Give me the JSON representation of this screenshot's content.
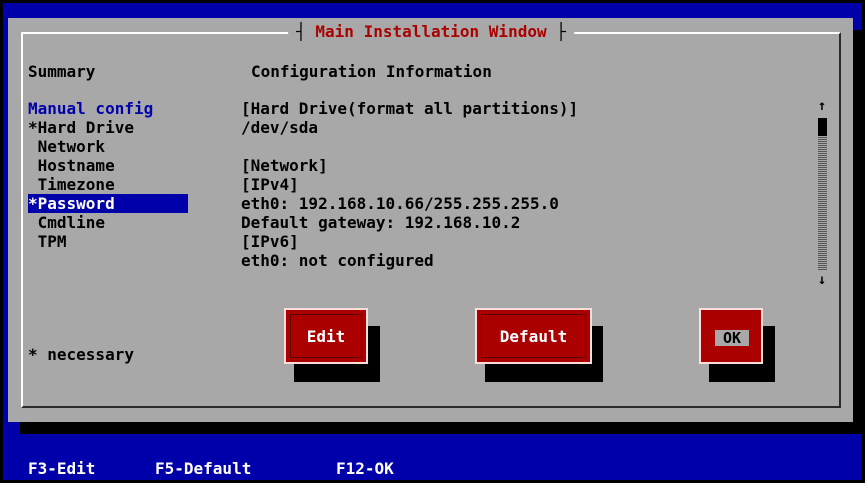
{
  "window": {
    "title": "Main Installation Window"
  },
  "headers": {
    "summary": "Summary",
    "config": "Configuration Information"
  },
  "sidebar": {
    "items": [
      {
        "label": "Manual config"
      },
      {
        "label": "*Hard Drive"
      },
      {
        "label": " Network"
      },
      {
        "label": " Hostname"
      },
      {
        "label": " Timezone"
      },
      {
        "label": "*Password"
      },
      {
        "label": " Cmdline"
      },
      {
        "label": " TPM"
      }
    ],
    "selected": "*Password",
    "note": "* necessary"
  },
  "config_lines": [
    "[Hard Drive(format all partitions)]",
    "/dev/sda",
    "",
    "[Network]",
    "[IPv4]",
    "eth0: 192.168.10.66/255.255.255.0",
    "Default gateway: 192.168.10.2",
    "[IPv6]",
    "eth0: not configured"
  ],
  "scrollbar": {
    "up_icon": "↑",
    "down_icon": "↓"
  },
  "buttons": {
    "edit": "Edit",
    "default": "Default",
    "ok": "OK"
  },
  "footer": {
    "f3": "F3-Edit",
    "f5": "F5-Default",
    "f12": "F12-OK"
  },
  "colors": {
    "background": "#0000aa",
    "window": "#a8a8a8",
    "accent": "#aa0000",
    "selection": "#0000aa"
  }
}
